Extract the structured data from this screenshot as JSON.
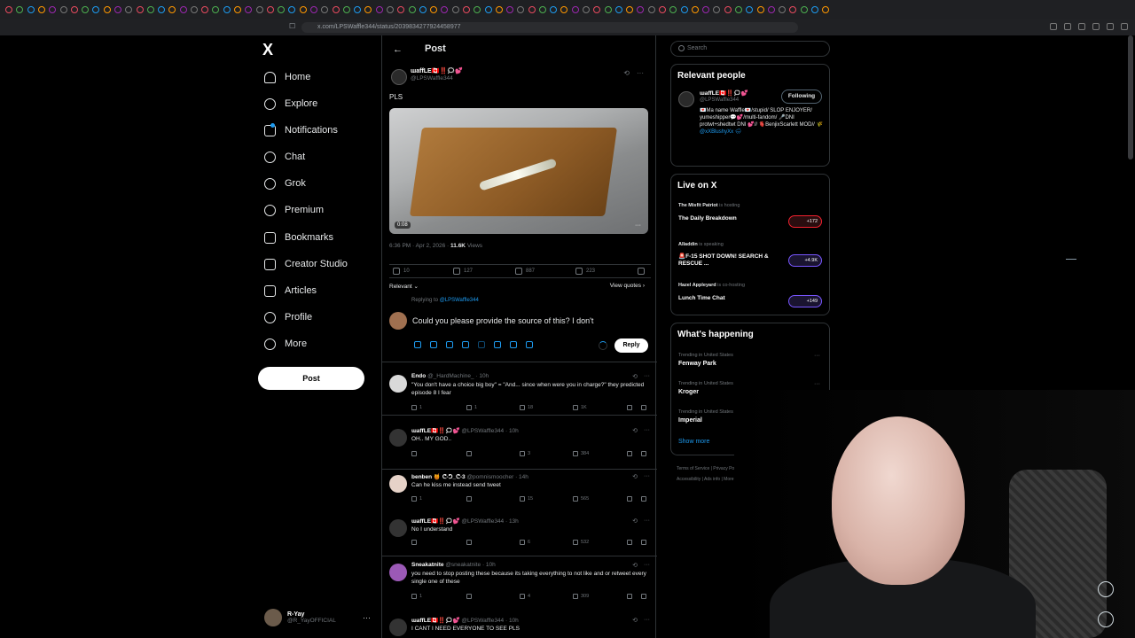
{
  "browser": {
    "url": "x.com/LPSWaffle344/status/2039834277924458977",
    "tab_count": 76
  },
  "nav": {
    "logo": "X",
    "items": [
      {
        "label": "Home",
        "icon": "home-icon"
      },
      {
        "label": "Explore",
        "icon": "search-icon"
      },
      {
        "label": "Notifications",
        "icon": "bell-icon"
      },
      {
        "label": "Chat",
        "icon": "chat-icon"
      },
      {
        "label": "Grok",
        "icon": "grok-icon"
      },
      {
        "label": "Premium",
        "icon": "premium-icon"
      },
      {
        "label": "Bookmarks",
        "icon": "bookmark-icon"
      },
      {
        "label": "Creator Studio",
        "icon": "creator-studio-icon"
      },
      {
        "label": "Articles",
        "icon": "articles-icon"
      },
      {
        "label": "Profile",
        "icon": "profile-icon"
      },
      {
        "label": "More",
        "icon": "more-icon"
      }
    ],
    "post_button": "Post",
    "account": {
      "name": "R-Yay",
      "handle": "@R_YayOFFICIAL",
      "more": "···"
    }
  },
  "post": {
    "header_title": "Post",
    "author_name": "ɯaffLE🇨🇦‼️🗯💕",
    "author_handle": "@LPSWaffle344",
    "text": "PLS",
    "video_duration": "0:08",
    "meta_time": "6:36 PM · Apr 2, 2026 · ",
    "meta_views_count": "11.6K",
    "meta_views_label": " Views",
    "actions": {
      "replies": "10",
      "reposts": "127",
      "likes": "887",
      "bookmarks": "223"
    },
    "sort_label": "Relevant ⌄",
    "view_quotes": "View quotes ›",
    "replying_prefix": "Replying to ",
    "replying_handle": "@LPSWaffle344",
    "reply_draft": "Could you please provide the source of this? I don't",
    "reply_button": "Reply"
  },
  "replies": [
    {
      "name": "Endo",
      "handle": "@_HardMachine_ · 10h",
      "text": "\"You don't have a choice big boy\" = \"And... since when were you in charge?\" they predicted episode 8 I fear",
      "replies": "1",
      "reposts": "1",
      "likes": "18",
      "views": "1K"
    },
    {
      "name": "ɯaffLE🇨🇦‼️🗯💕",
      "handle": "@LPSWaffle344 · 10h",
      "text": "OH.. MY GOD..",
      "replies": "",
      "reposts": "",
      "likes": "3",
      "views": "384"
    },
    {
      "name": "benben 🍯 ᕦ-ᕤ_ᕦ-3",
      "handle": "@pomnismoocher · 14h",
      "text": "Can he kiss me instead send tweet",
      "replies": "1",
      "reposts": "",
      "likes": "15",
      "views": "565"
    },
    {
      "name": "ɯaffLE🇨🇦‼️🗯💕",
      "handle": "@LPSWaffle344 · 13h",
      "text": "No I understand",
      "replies": "",
      "reposts": "",
      "likes": "6",
      "views": "532"
    },
    {
      "name": "Sneakatnite",
      "handle": "@sneakatnite · 10h",
      "text": "you need to stop posting these because its taking everything to not like and or retweet every single one of these",
      "replies": "1",
      "reposts": "",
      "likes": "4",
      "views": "309"
    },
    {
      "name": "ɯaffLE🇨🇦‼️🗯💕",
      "handle": "@LPSWaffle344 · 10h",
      "text": "I CANT I NEED EVERYONE TO SEE PLS",
      "replies": "",
      "reposts": "",
      "likes": "",
      "views": ""
    }
  ],
  "sidebar": {
    "search_placeholder": "Search",
    "relevant_title": "Relevant people",
    "person": {
      "name": "ɯaffLE🇨🇦‼️🗯💕",
      "handle": "@LPSWaffle344",
      "follow_label": "Following",
      "bio": "💌Ma name Waffle💌/stupid/ SLOP ENJOYER/ yumeshipper💬💕/multi-fandom/ 🎤DNI protwt+shedtwt DNI 💕// 🫀BenjixScarlett MOD// 🌾",
      "bio_link": "@xXBlushyXx 🌧"
    },
    "live_title": "Live on X",
    "live": [
      {
        "host": "The Misfit Patriot",
        "status": " is hosting",
        "title": "The Daily Breakdown",
        "badge": "+172"
      },
      {
        "host": "Alladdin",
        "status": " is speaking",
        "title": "🚨F-15 SHOT DOWN! SEARCH & RESCUE ...",
        "badge": "+4.9K"
      },
      {
        "host": "Hazel Appleyard",
        "status": " is co-hosting",
        "title": "Lunch Time Chat",
        "badge": "+149"
      }
    ],
    "happening_title": "What's happening",
    "trends": [
      {
        "context": "Trending in United States",
        "name": "Fenway Park"
      },
      {
        "context": "Trending in United States",
        "name": "Kroger"
      },
      {
        "context": "Trending in United States",
        "name": "Imperial"
      }
    ],
    "show_more": "Show more",
    "footer_line1": "Terms of Service  |  Privacy Policy  |  Cookie Policy  |",
    "footer_line2": "Accessibility  |  Ads info  |  More ···  © 2026 X Corp."
  },
  "colors": {
    "accent": "#1d9bf0",
    "background": "#000000",
    "border": "#2f3336",
    "muted": "#71767b"
  }
}
